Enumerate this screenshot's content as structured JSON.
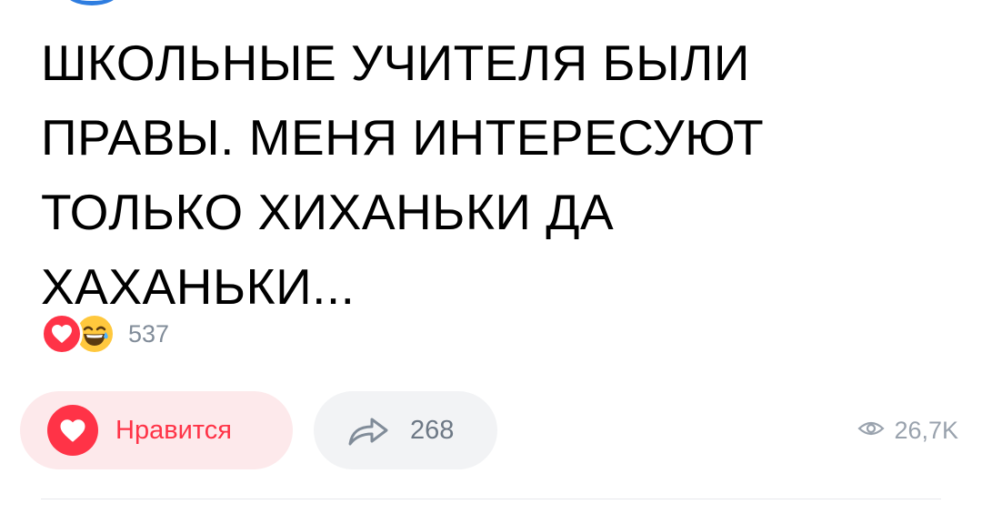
{
  "post": {
    "text_lines": [
      "ШКОЛЬНЫЕ УЧИТЕЛЯ БЫЛИ",
      "ПРАВЫ. МЕНЯ ИНТЕРЕСУЮТ",
      "ТОЛЬКО ХИХАНЬКИ ДА",
      "ХАХАНЬКИ..."
    ]
  },
  "reactions": {
    "icons": [
      "heart-reaction-icon",
      "laughing-with-tears-reaction-icon"
    ],
    "count": "537"
  },
  "actions": {
    "like_label": "Нравится",
    "share_count": "268"
  },
  "views": {
    "count": "26,7K"
  },
  "colors": {
    "like_red": "#ff3347",
    "like_bg": "#fde9eb",
    "share_bg": "#f2f3f5",
    "muted_text": "#818c99",
    "laugh_yellow": "#ffc83d",
    "avatar_blue": "#2e7de0"
  }
}
